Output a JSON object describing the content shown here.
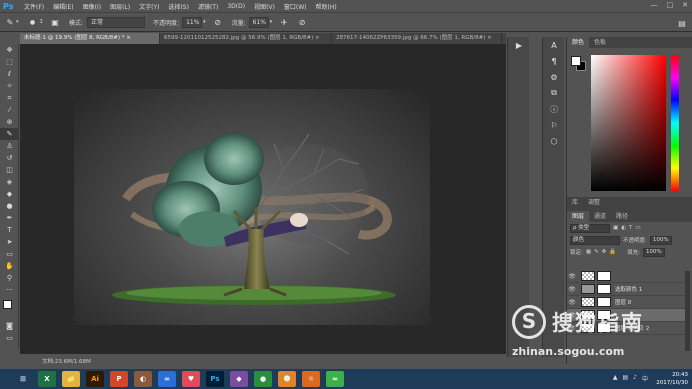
{
  "app": {
    "logo": "Ps"
  },
  "menu": [
    "文件(F)",
    "编辑(E)",
    "图像(I)",
    "图层(L)",
    "文字(Y)",
    "选择(S)",
    "滤镜(T)",
    "3D(D)",
    "视图(V)",
    "窗口(W)",
    "帮助(H)"
  ],
  "window_controls": [
    "—",
    "□",
    "✕"
  ],
  "options": {
    "brush_size": "1",
    "mode_label": "模式:",
    "mode_value": "正常",
    "opacity_label": "不透明度:",
    "opacity_value": "11%",
    "flow_label": "流量:",
    "flow_value": "61%"
  },
  "tabs": [
    "未标题-1 @ 19.9% (图层 8, RGB/8#) * ×",
    "6599-12011012525282.jpg @ 56.9% (图层 1, RGB/8#) ×",
    "287617-14062ZP63359.jpg @ 66.7% (图层 1, RGB/8#) ×"
  ],
  "status": {
    "docsize": "文档:23.6M/1.68M"
  },
  "panels": {
    "color_tabs": [
      "颜色",
      "色板"
    ],
    "adj_tabs": [
      "库",
      "调整"
    ],
    "layer_tabs": [
      "图层",
      "通道",
      "路径"
    ]
  },
  "layers_panel": {
    "filter_label": "ρ 类型",
    "blend_mode": "颜色",
    "opacity_label": "不透明度:",
    "opacity_value": "100%",
    "lock_label": "锁定:",
    "fill_label": "填充:",
    "fill_value": "100%",
    "layers": [
      {
        "name": "",
        "selected": false,
        "mask": true
      },
      {
        "name": "选取颜色 1",
        "selected": false,
        "mask": true
      },
      {
        "name": "图层 8",
        "selected": false,
        "mask": true
      },
      {
        "name": "",
        "selected": true,
        "mask": true
      },
      {
        "name": "图层 7 拷贝 2",
        "selected": false,
        "mask": true
      }
    ]
  },
  "taskbar": {
    "icons": [
      "X",
      "📁",
      "Ai",
      "P",
      "◐",
      "∞",
      "♥",
      "Ps",
      "◆",
      "●",
      "☻",
      "☼",
      "≈"
    ],
    "time": "20:43",
    "date": "2017/10/30"
  },
  "watermark": {
    "cn": "搜狗指南",
    "url": "zhinan.sogou.com"
  },
  "colors": {
    "accent": "#31a8ff",
    "taskbar": "#1f3b5a"
  }
}
